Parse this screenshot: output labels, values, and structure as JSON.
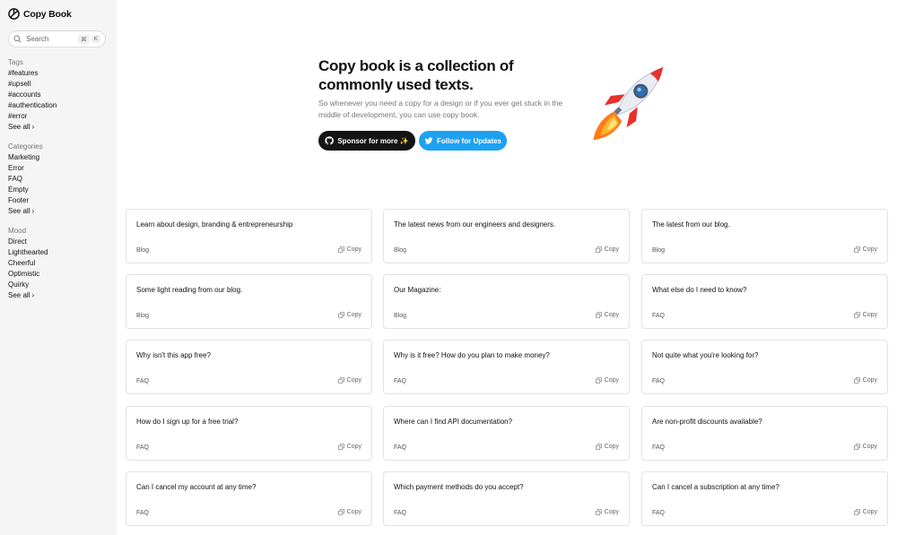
{
  "app": {
    "name": "Copy Book"
  },
  "search": {
    "placeholder": "Search",
    "shortcut_key1": "⌘",
    "shortcut_key2": "K"
  },
  "sidebar": {
    "tags": {
      "heading": "Tags",
      "items": [
        "#features",
        "#upsell",
        "#accounts",
        "#authentication",
        "#error"
      ],
      "see_all": "See all"
    },
    "categories": {
      "heading": "Categories",
      "items": [
        "Marketing",
        "Error",
        "FAQ",
        "Empty",
        "Footer"
      ],
      "see_all": "See all"
    },
    "mood": {
      "heading": "Mood",
      "items": [
        "Direct",
        "Lighthearted",
        "Cheerful",
        "Optimistic",
        "Quirky"
      ],
      "see_all": "See all"
    }
  },
  "hero": {
    "title": "Copy book is a collection of commonly used texts.",
    "subtitle": "So whenever you need a copy for a design or if you ever get stuck in the middle of development, you can use copy book.",
    "sponsor_label": "Sponsor for more ✨",
    "follow_label": "Follow for Updates"
  },
  "colors": {
    "sponsor_button": "#141414",
    "follow_button": "#1da1f2",
    "sidebar_bg": "#f5f5f5"
  },
  "cards": [
    {
      "text": "Learn about design, branding & entrepreneurship",
      "tag": "Blog",
      "copy_label": "Copy"
    },
    {
      "text": "The latest news from our engineers and designers.",
      "tag": "Blog",
      "copy_label": "Copy"
    },
    {
      "text": "The latest from our blog.",
      "tag": "Blog",
      "copy_label": "Copy"
    },
    {
      "text": "Some light reading from our blog.",
      "tag": "Blog",
      "copy_label": "Copy"
    },
    {
      "text": "Our Magazine:",
      "tag": "Blog",
      "copy_label": "Copy"
    },
    {
      "text": "What else do I need to know?",
      "tag": "FAQ",
      "copy_label": "Copy"
    },
    {
      "text": "Why isn't this app free?",
      "tag": "FAQ",
      "copy_label": "Copy"
    },
    {
      "text": "Why is it free? How do you plan to make money?",
      "tag": "FAQ",
      "copy_label": "Copy"
    },
    {
      "text": "Not quite what you're looking for?",
      "tag": "FAQ",
      "copy_label": "Copy"
    },
    {
      "text": "How do I sign up for a free trial?",
      "tag": "FAQ",
      "copy_label": "Copy"
    },
    {
      "text": "Where can I find API documentation?",
      "tag": "FAQ",
      "copy_label": "Copy"
    },
    {
      "text": "Are non-profit discounts available?",
      "tag": "FAQ",
      "copy_label": "Copy"
    },
    {
      "text": "Can I cancel my account at any time?",
      "tag": "FAQ",
      "copy_label": "Copy"
    },
    {
      "text": "Which payment methods do you accept?",
      "tag": "FAQ",
      "copy_label": "Copy"
    },
    {
      "text": "Can I cancel a subscription at any time?",
      "tag": "FAQ",
      "copy_label": "Copy"
    }
  ]
}
